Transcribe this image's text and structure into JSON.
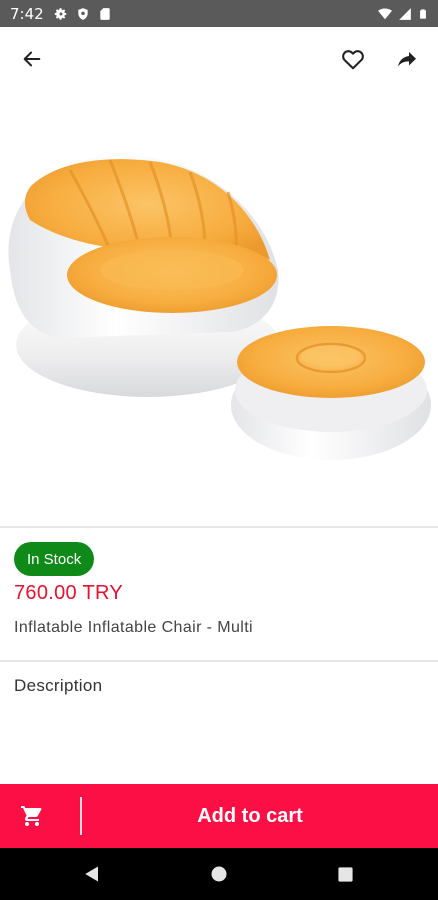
{
  "status_bar": {
    "time": "7:42",
    "left_icons": [
      "settings-icon",
      "shield-icon",
      "sd-card-icon"
    ],
    "right_icons": [
      "wifi-icon",
      "signal-icon",
      "battery-icon"
    ]
  },
  "app_bar": {
    "icons": [
      "back-arrow-icon",
      "heart-icon",
      "share-icon"
    ]
  },
  "product": {
    "image": "inflatable-chair-with-ottoman",
    "stock_label": "In Stock",
    "price": "760.00 TRY",
    "name": "Inflatable Inflatable Chair - Multi"
  },
  "description": {
    "title": "Description"
  },
  "cart": {
    "label": "Add to cart",
    "icon": "cart-icon"
  },
  "colors": {
    "accent": "#fc0f45",
    "price": "#e8102c",
    "stock": "#0f8a19"
  },
  "nav": {
    "icons": [
      "back-triangle-icon",
      "home-circle-icon",
      "recents-square-icon"
    ]
  }
}
